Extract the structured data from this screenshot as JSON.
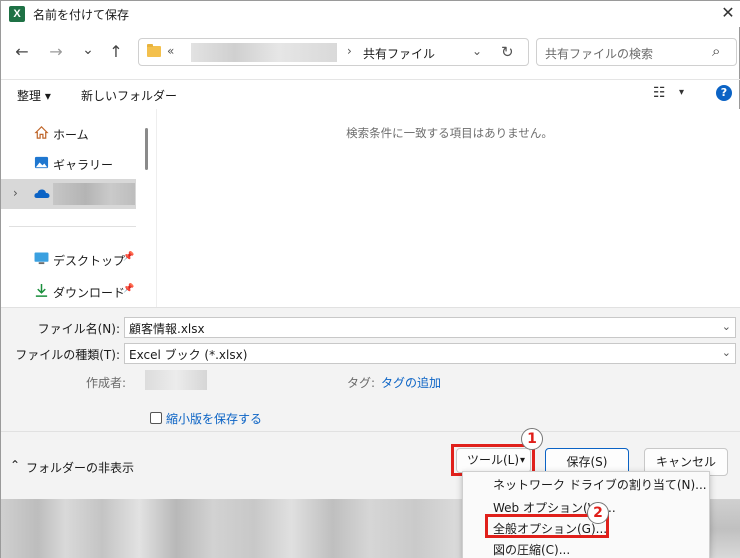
{
  "window": {
    "title": "名前を付けて保存",
    "app_icon": "X",
    "close_glyph": "✕"
  },
  "nav": {
    "back_glyph": "←",
    "forward_glyph": "→",
    "recent_glyph": "⌄",
    "up_glyph": "↑",
    "path_prefix": "«",
    "path_sep": "›",
    "path_current": "共有ファイル",
    "refresh_glyph": "↻",
    "search_placeholder": "共有ファイルの検索",
    "search_glyph": "⌕"
  },
  "toolbar": {
    "organize": "整理 ▾",
    "new_folder": "新しいフォルダー",
    "view_glyph": "☷",
    "view_caret": "▾",
    "help": "?"
  },
  "sidebar": {
    "items": [
      {
        "label": "ホーム",
        "icon": "home-icon"
      },
      {
        "label": "ギャラリー",
        "icon": "gallery-icon"
      },
      {
        "label": "",
        "icon": "onedrive-icon"
      },
      {
        "label": "デスクトップ",
        "icon": "desktop-icon"
      },
      {
        "label": "ダウンロード",
        "icon": "download-icon"
      }
    ],
    "expand_glyph": "›",
    "pin_glyph": "📌"
  },
  "content": {
    "empty_message": "検索条件に一致する項目はありません。"
  },
  "form": {
    "filename_label": "ファイル名(N):",
    "filename_value": "顧客情報.xlsx",
    "filetype_label": "ファイルの種類(T):",
    "filetype_value": "Excel ブック (*.xlsx)",
    "author_label": "作成者:",
    "tags_label": "タグ:",
    "tags_link": "タグの追加",
    "thumbnail_label": "縮小版を保存する",
    "combo_glyph": "⌄"
  },
  "footer": {
    "hide_folders_glyph": "⌃",
    "hide_folders": "フォルダーの非表示",
    "tools_button": "ツール(L)",
    "tools_caret": "▾",
    "save_button": "保存(S)",
    "cancel_button": "キャンセル"
  },
  "annotations": {
    "step1": "1",
    "step2": "2",
    "highlight_color": "#e0201b"
  },
  "tools_menu": {
    "items": [
      "ネットワーク ドライブの割り当て(N)...",
      "Web オプション(W)...",
      "全般オプション(G)...",
      "図の圧縮(C)..."
    ]
  },
  "colors": {
    "accent": "#0b63c5",
    "excel_green": "#1e7145"
  }
}
